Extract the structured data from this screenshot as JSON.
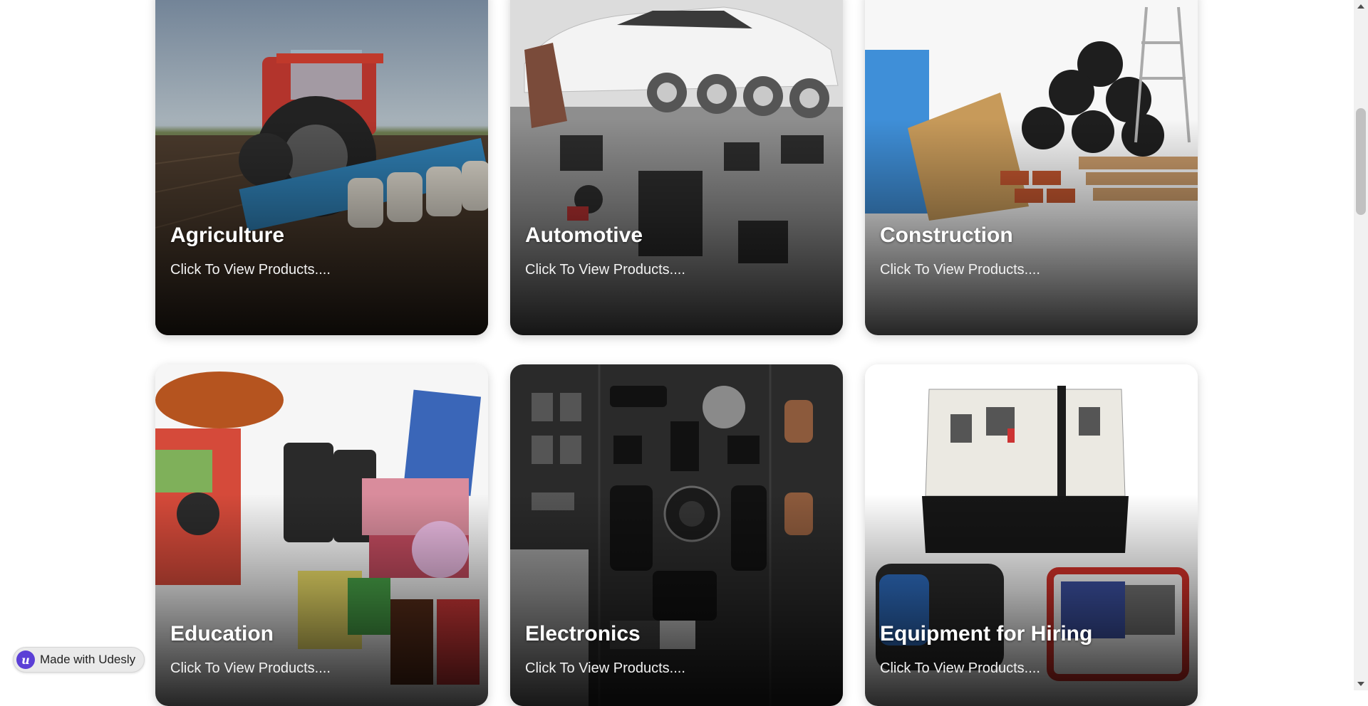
{
  "categories": [
    {
      "title": "Agriculture",
      "cta": "Click To View Products...."
    },
    {
      "title": "Automotive",
      "cta": "Click To View Products...."
    },
    {
      "title": "Construction",
      "cta": "Click To View Products...."
    },
    {
      "title": "Education",
      "cta": "Click To View Products...."
    },
    {
      "title": "Electronics",
      "cta": "Click To View Products...."
    },
    {
      "title": "Equipment for Hiring",
      "cta": "Click To View Products...."
    }
  ],
  "badge": {
    "logo_letter": "u",
    "label": "Made with Udesly",
    "icon": "udesly-logo-icon"
  },
  "colors": {
    "badge_accent": "#5b3fd6",
    "card_text": "#ffffff"
  }
}
